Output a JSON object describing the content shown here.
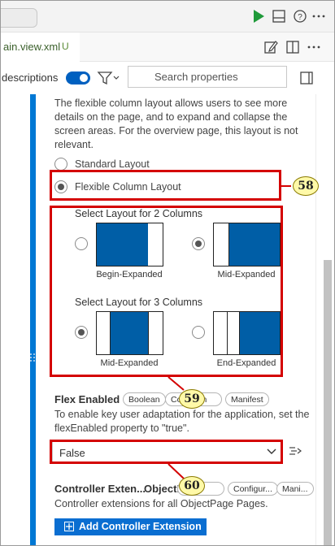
{
  "tab": {
    "file_name": "ain.view.xml",
    "status_badge": "U"
  },
  "toolbar": {
    "descriptions_label": "descriptions",
    "search_placeholder": "Search properties"
  },
  "layout_section": {
    "description": "The flexible column layout allows users to see more details on the page, and to expand and collapse the screen areas. For the overview page, this layout is not relevant.",
    "options": [
      {
        "label": "Standard Layout",
        "selected": false
      },
      {
        "label": "Flexible Column Layout",
        "selected": true
      }
    ],
    "two_columns": {
      "title": "Select Layout for 2 Columns",
      "options": [
        {
          "caption": "Begin-Expanded",
          "selected": false
        },
        {
          "caption": "Mid-Expanded",
          "selected": true
        }
      ]
    },
    "three_columns": {
      "title": "Select Layout for 3 Columns",
      "options": [
        {
          "caption": "Mid-Expanded",
          "selected": true
        },
        {
          "caption": "End-Expanded",
          "selected": false
        }
      ]
    }
  },
  "flex_enabled": {
    "title": "Flex Enabled",
    "chips": [
      "Boolean",
      "Condition",
      "Manifest"
    ],
    "description": "To enable key user adaptation for the application, set the flexEnabled property to \"true\".",
    "value": "False"
  },
  "controller_extensions": {
    "title": "Controller Exten...",
    "subtitle": "ObjectP",
    "chips": [
      "Ar...",
      "Configur...",
      "Mani..."
    ],
    "description": "Controller extensions for all ObjectPage Pages.",
    "add_button_label": "Add Controller Extension"
  },
  "callouts": [
    "58",
    "59",
    "60"
  ],
  "colors": {
    "accent": "#0060c0",
    "layout_fill": "#005ea6",
    "highlight": "#d40000",
    "callout_fill": "#fff9a8"
  }
}
